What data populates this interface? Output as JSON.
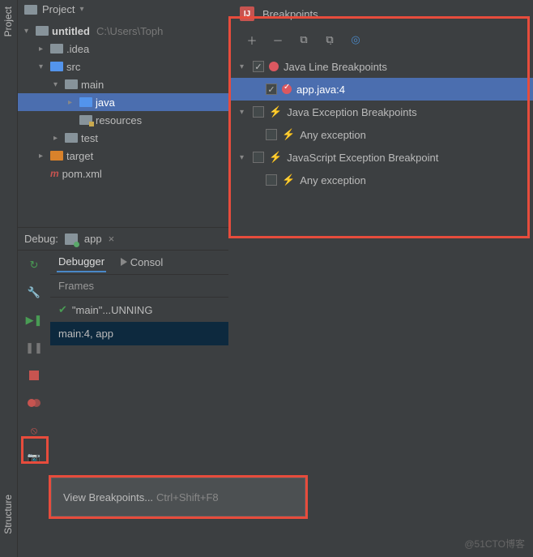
{
  "sidebar": {
    "project": "Project",
    "structure": "Structure"
  },
  "project": {
    "header": "Project",
    "root_name": "untitled",
    "root_path": "C:\\Users\\Toph",
    "tree": [
      {
        "label": ".idea",
        "icon": "folder",
        "indent": 1,
        "arrow": "right"
      },
      {
        "label": "src",
        "icon": "folder-blue",
        "indent": 1,
        "arrow": "down"
      },
      {
        "label": "main",
        "icon": "folder",
        "indent": 2,
        "arrow": "down"
      },
      {
        "label": "java",
        "icon": "folder-blue",
        "indent": 3,
        "arrow": "right",
        "selected": true
      },
      {
        "label": "resources",
        "icon": "folder-res",
        "indent": 3,
        "arrow": "none"
      },
      {
        "label": "test",
        "icon": "folder",
        "indent": 2,
        "arrow": "right"
      },
      {
        "label": "target",
        "icon": "folder-orange",
        "indent": 1,
        "arrow": "right"
      },
      {
        "label": "pom.xml",
        "icon": "file-m",
        "indent": 1,
        "arrow": "none"
      }
    ]
  },
  "debug": {
    "title": "Debug:",
    "config": "app",
    "tabs": {
      "debugger": "Debugger",
      "console": "Consol"
    },
    "frames_label": "Frames",
    "frame_running": "\"main\"...UNNING",
    "frame_current": "main:4, app"
  },
  "menu": {
    "label": "View Breakpoints...",
    "shortcut": "Ctrl+Shift+F8"
  },
  "breakpoints": {
    "title": "Breakpoints",
    "nodes": [
      {
        "label": "Java Line Breakpoints",
        "indent": 0,
        "arrow": "down",
        "checked": true,
        "icon": "dot"
      },
      {
        "label": "app.java:4",
        "indent": 1,
        "arrow": "none",
        "checked": true,
        "icon": "dot-check",
        "selected": true
      },
      {
        "label": "Java Exception Breakpoints",
        "indent": 0,
        "arrow": "down",
        "checked": false,
        "icon": "bolt"
      },
      {
        "label": "Any exception",
        "indent": 1,
        "arrow": "none",
        "checked": false,
        "icon": "bolt"
      },
      {
        "label": "JavaScript Exception Breakpoint",
        "indent": 0,
        "arrow": "down",
        "checked": false,
        "icon": "bolt"
      },
      {
        "label": "Any exception",
        "indent": 1,
        "arrow": "none",
        "checked": false,
        "icon": "bolt"
      }
    ]
  },
  "watermark": "@51CTO博客"
}
